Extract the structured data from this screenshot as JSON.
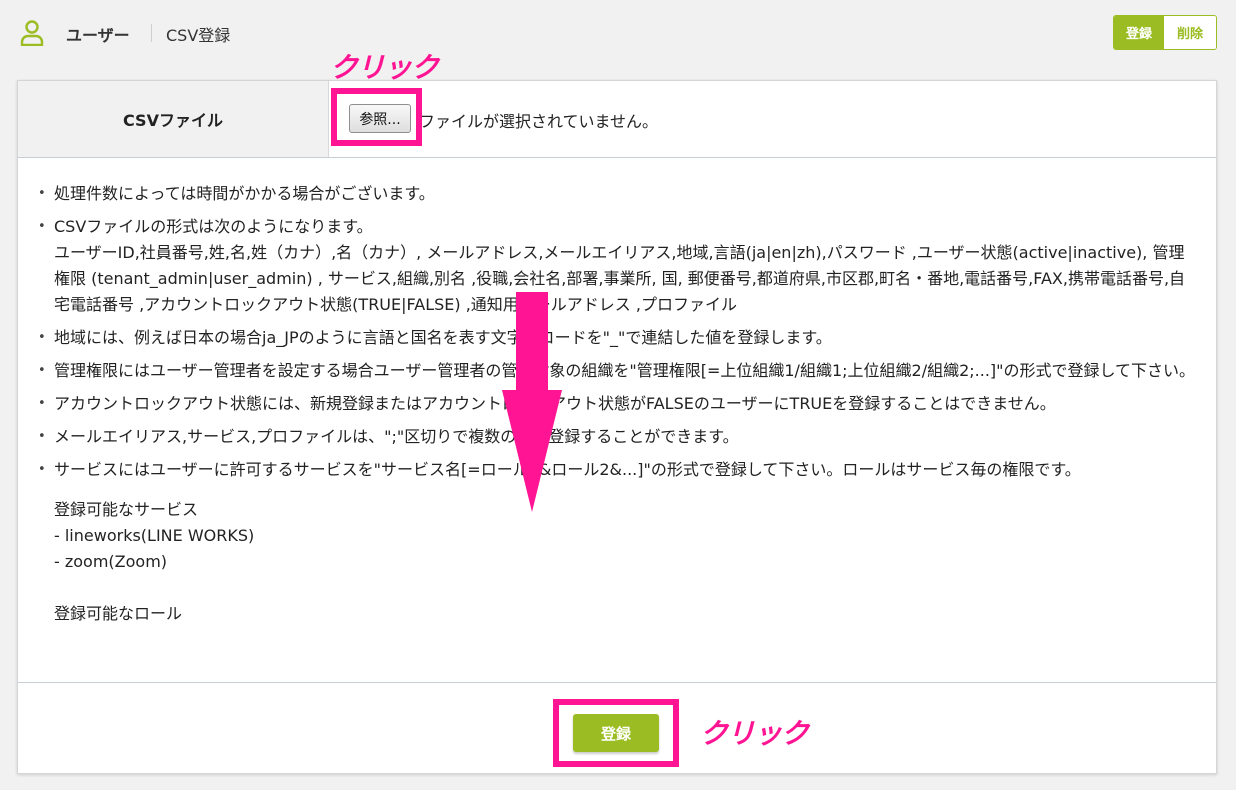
{
  "header": {
    "title": "ユーザー",
    "subtitle": "CSV登録",
    "register_label": "登録",
    "delete_label": "削除"
  },
  "annotations": {
    "click_top": "クリック",
    "click_bottom": "クリック"
  },
  "file_row": {
    "label": "CSVファイル",
    "browse_label": "参照...",
    "status": "ファイルが選択されていません。"
  },
  "notes": {
    "items": [
      "処理件数によっては時間がかかる場合がございます。",
      "CSVファイルの形式は次のようになります。",
      "地域には、例えば日本の場合ja_JPのように言語と国名を表す文字のコードを\"_\"で連結した値を登録します。",
      "管理権限にはユーザー管理者を設定する場合ユーザー管理者の管理対象の組織を\"管理権限[=上位組織1/組織1;上位組織2/組織2;...]\"の形式で登録して下さい。",
      "アカウントロックアウト状態には、新規登録またはアカウントロックアウト状態がFALSEのユーザーにTRUEを登録することはできません。",
      "メールエイリアス,サービス,プロファイルは、\";\"区切りで複数の値を登録することができます。",
      "サービスにはユーザーに許可するサービスを\"サービス名[=ロール1&ロール2&...]\"の形式で登録して下さい。ロールはサービス毎の権限です。"
    ],
    "csv_format": "ユーザーID,社員番号,姓,名,姓（カナ）,名（カナ）, メールアドレス,メールエイリアス,地域,言語(ja|en|zh),パスワード ,ユーザー状態(active|inactive), 管理権限 (tenant_admin|user_admin) , サービス,組織,別名 ,役職,会社名,部署,事業所, 国, 郵便番号,都道府県,市区郡,町名・番地,電話番号,FAX,携帯電話番号,自宅電話番号 ,アカウントロックアウト状態(TRUE|FALSE) ,通知用メールアドレス ,プロファイル",
    "services_heading": "登録可能なサービス",
    "service_1": "- lineworks(LINE WORKS)",
    "service_2": "- zoom(Zoom)",
    "roles_heading": "登録可能なロール"
  },
  "footer": {
    "register_label": "登録"
  },
  "colors": {
    "accent": "#9bbd23",
    "highlight": "#ff1493"
  }
}
